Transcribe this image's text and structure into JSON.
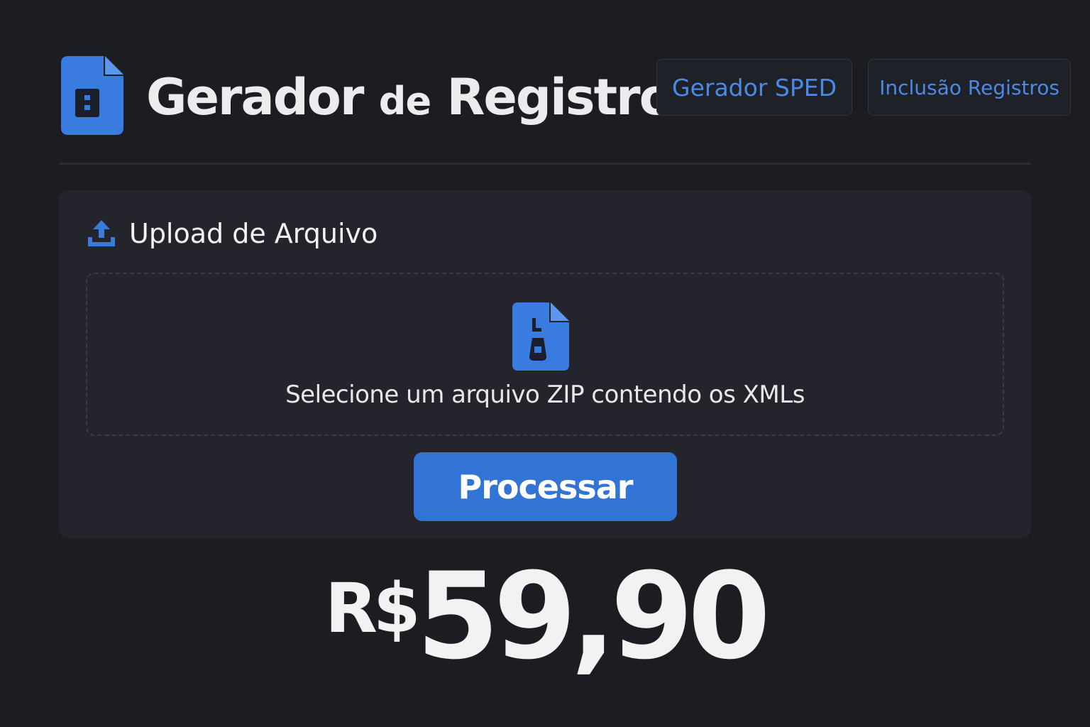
{
  "header": {
    "logo_icon": "document-icon",
    "title_part1": "Gerador",
    "title_part2": "de",
    "title_part3": "Registros",
    "nav": [
      {
        "label": "Gerador SPED"
      },
      {
        "label": "Inclusão Registros"
      }
    ]
  },
  "upload": {
    "icon": "upload-icon",
    "title": "Upload de Arquivo",
    "dropzone": {
      "icon": "zip-file-icon",
      "text": "Selecione um arquivo ZIP contendo os XMLs"
    },
    "button_label": "Processar"
  },
  "price": {
    "currency": "R$",
    "amount": "59,90"
  },
  "colors": {
    "background": "#1c1d22",
    "card": "#24252c",
    "accent": "#3273d6",
    "nav_text": "#4a8ae6"
  }
}
